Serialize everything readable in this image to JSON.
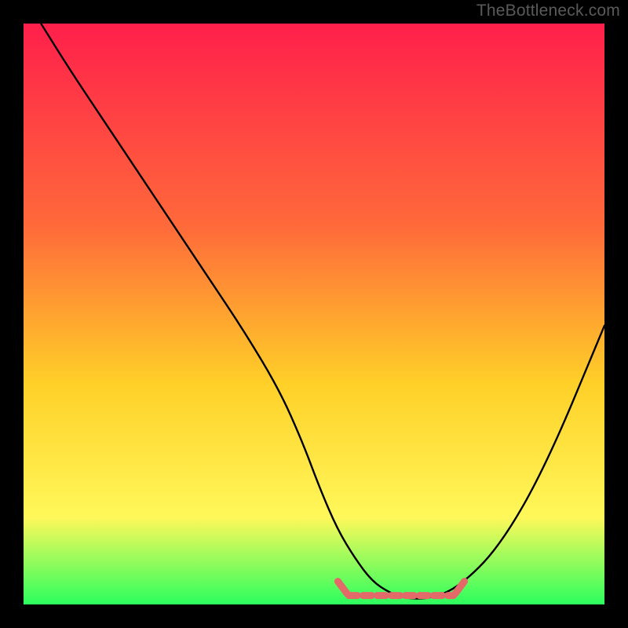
{
  "watermark": "TheBottleneck.com",
  "colors": {
    "bg_black": "#000000",
    "grad_top": "#ff1f4b",
    "grad_mid1": "#ff6a3a",
    "grad_mid2": "#ffd028",
    "grad_mid3": "#fff85a",
    "grad_bottom": "#2bff5e",
    "curve": "#000000",
    "dash": "#e46a6a",
    "watermark_color": "#5a5a5a"
  },
  "chart_data": {
    "type": "line",
    "title": "",
    "xlabel": "",
    "ylabel": "",
    "xlim": [
      0,
      100
    ],
    "ylim": [
      0,
      100
    ],
    "series": [
      {
        "name": "bottleneck-curve",
        "x": [
          3,
          8,
          14,
          20,
          26,
          32,
          38,
          44,
          48,
          51,
          54,
          57,
          60,
          63,
          66,
          70,
          75,
          82,
          90,
          100
        ],
        "y": [
          100,
          92,
          83,
          74,
          65,
          56,
          47,
          37,
          28,
          20,
          13,
          8,
          4,
          2,
          1,
          1,
          3,
          10,
          24,
          48
        ]
      }
    ],
    "flat_region": {
      "x_start": 56,
      "x_end": 74,
      "y": 1
    },
    "annotations": []
  }
}
